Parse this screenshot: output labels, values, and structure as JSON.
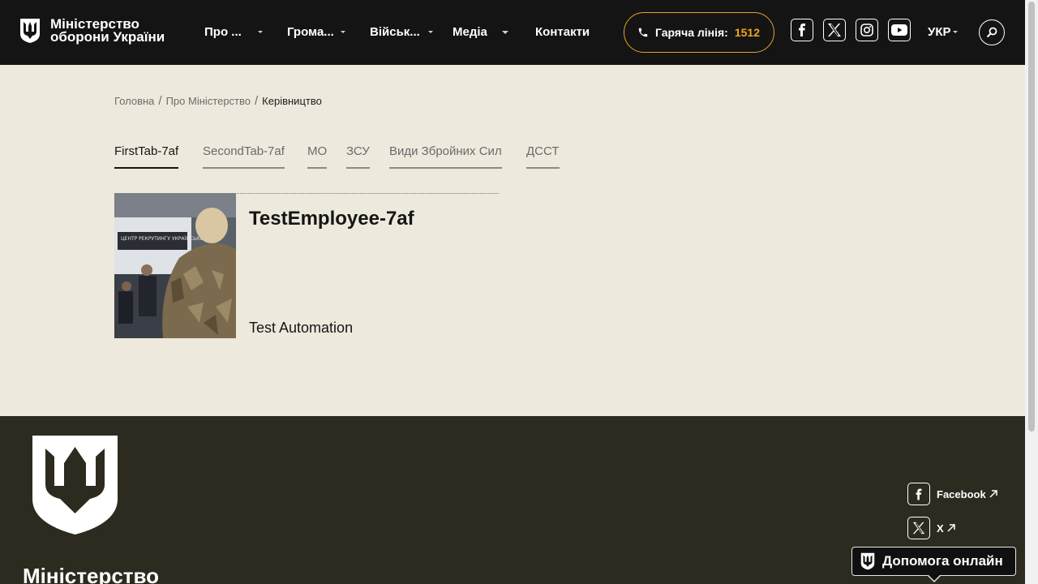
{
  "header": {
    "logo_line1": "Міністерство",
    "logo_line2": "оборони України",
    "nav": [
      {
        "label": "Про ..."
      },
      {
        "label": "Грома..."
      },
      {
        "label": "Військ..."
      },
      {
        "label": "Медіа"
      },
      {
        "label": "Контакти"
      }
    ],
    "hotline_label": "Гаряча лінія:",
    "hotline_number": "1512",
    "hotline_color": "#f4a51c",
    "social_icons": [
      "facebook-icon",
      "x-icon",
      "instagram-icon",
      "youtube-icon"
    ],
    "language": "УКР"
  },
  "breadcrumb": {
    "items": [
      "Головна",
      "Про Міністерство",
      "Керівництво"
    ],
    "separator": "/"
  },
  "tabs": [
    {
      "label": "FirstTab-7af",
      "active": true
    },
    {
      "label": "SecondTab-7af",
      "active": false
    },
    {
      "label": "МО",
      "active": false
    },
    {
      "label": "ЗСУ",
      "active": false
    },
    {
      "label": "Види Збройних Сил",
      "active": false
    },
    {
      "label": "ДССТ",
      "active": false
    }
  ],
  "employee": {
    "name": "TestEmployee-7af",
    "position": "Test Automation",
    "photo_sign": "ЦЕНТР РЕКРУТИНГУ УКРАЇНСЬКОЇ АРМІЇ"
  },
  "footer": {
    "title": "Міністерство",
    "social": [
      {
        "label": "Facebook",
        "icon": "facebook-icon"
      },
      {
        "label": "X",
        "icon": "x-icon"
      }
    ]
  },
  "help_button": {
    "label": "Допомога онлайн"
  },
  "colors": {
    "header_bg": "#141414",
    "page_bg": "#ede9dc",
    "footer_bg": "#2d2a1f",
    "accent": "#e3a42c"
  }
}
